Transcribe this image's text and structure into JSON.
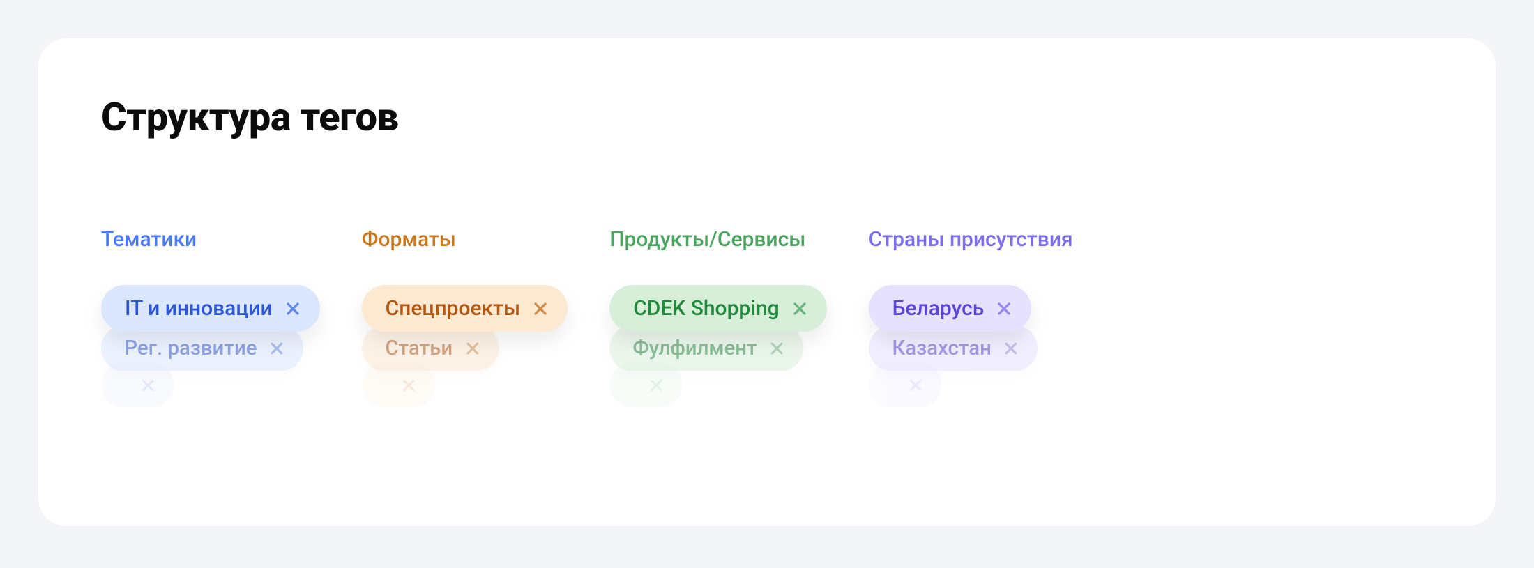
{
  "title": "Структура тегов",
  "columns": [
    {
      "header": "Тематики",
      "theme": "blue",
      "tags": [
        "IT и инновации",
        "Рег. развитие",
        ""
      ]
    },
    {
      "header": "Форматы",
      "theme": "orange",
      "tags": [
        "Спецпроекты",
        "Статьи",
        ""
      ]
    },
    {
      "header": "Продукты/Сервисы",
      "theme": "green",
      "tags": [
        "CDEK Shopping",
        "Фулфилмент",
        ""
      ]
    },
    {
      "header": "Страны присутствия",
      "theme": "purple",
      "tags": [
        "Беларусь",
        "Казахстан",
        ""
      ]
    }
  ]
}
